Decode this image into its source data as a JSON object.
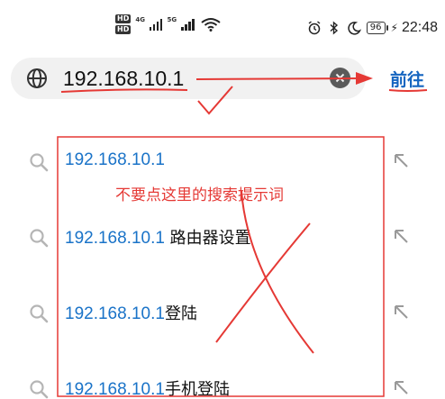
{
  "status_bar": {
    "hd_badge_1": "HD",
    "hd_badge_2": "HD",
    "network_1": "4G",
    "network_2": "5G",
    "battery": "96",
    "time": "22:48"
  },
  "search": {
    "url_value": "192.168.10.1",
    "go_label": "前往"
  },
  "suggestions": [
    {
      "ip": "192.168.10.1",
      "rest": ""
    },
    {
      "ip": "192.168.10.1",
      "rest": " 路由器设置"
    },
    {
      "ip": "192.168.10.1",
      "rest": "登陆"
    },
    {
      "ip": "192.168.10.1",
      "rest": "手机登陆"
    }
  ],
  "annotation": {
    "note": "不要点这里的搜索提示词"
  },
  "colors": {
    "accent_blue": "#1565c0",
    "link_blue": "#1a73c8",
    "annotation_red": "#e53935",
    "searchbar_bg": "#f1f1f1"
  },
  "icons": {
    "search_bar": "globe-icon",
    "clear": "clear-icon",
    "suggestion": "search-icon",
    "fill": "arrow-up-left-icon"
  }
}
